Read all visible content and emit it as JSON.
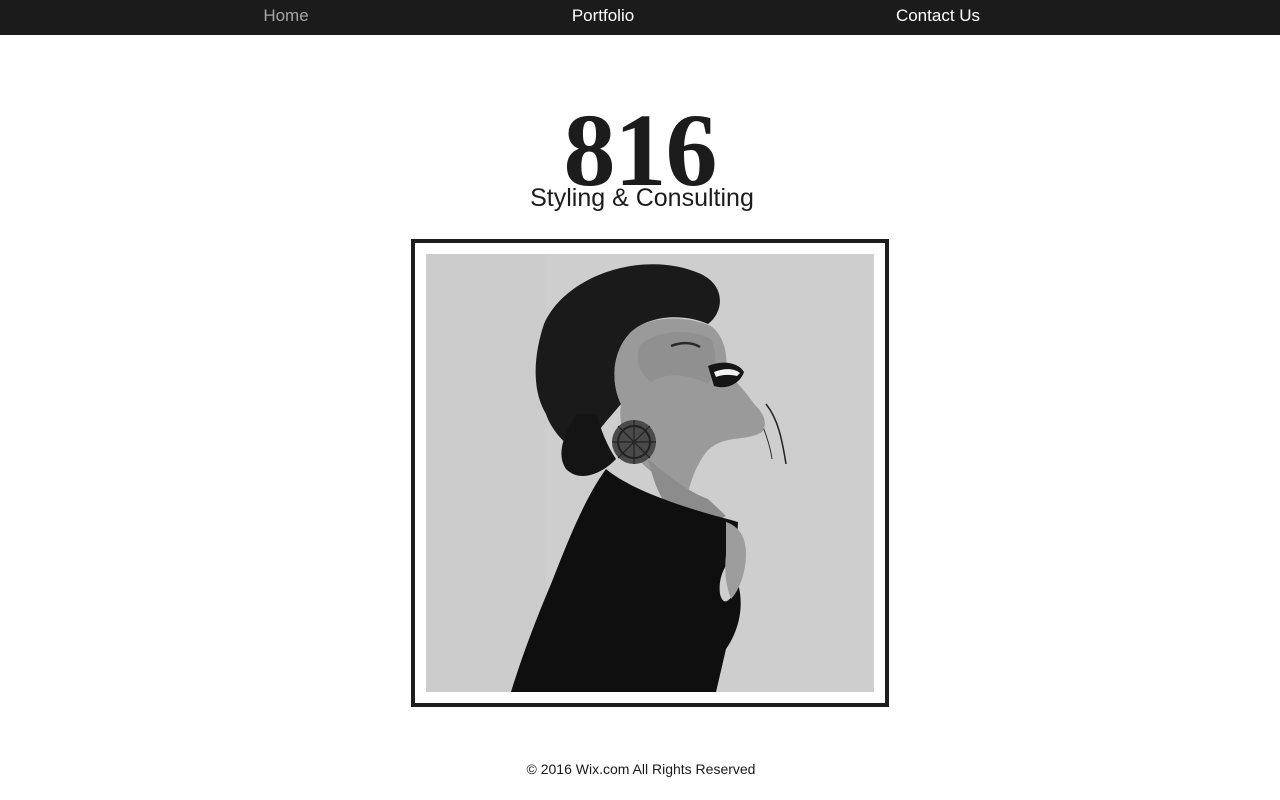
{
  "nav": {
    "items": [
      {
        "label": "Home",
        "active": true
      },
      {
        "label": "Portfolio",
        "active": false
      },
      {
        "label": "Contact Us",
        "active": false
      }
    ]
  },
  "header": {
    "logo": "816",
    "tagline": "Styling & Consulting"
  },
  "hero": {
    "image_subject": "black-and-white portrait of a laughing woman in a black high-neck top"
  },
  "footer": {
    "copyright": "© 2016 Wix.com All Rights Reserved"
  },
  "colors": {
    "navbar_bg": "#1b1b1b",
    "nav_text": "#ffffff",
    "nav_active": "#a6a6a6",
    "frame": "#1e1e1e",
    "text": "#1c1c1c"
  }
}
